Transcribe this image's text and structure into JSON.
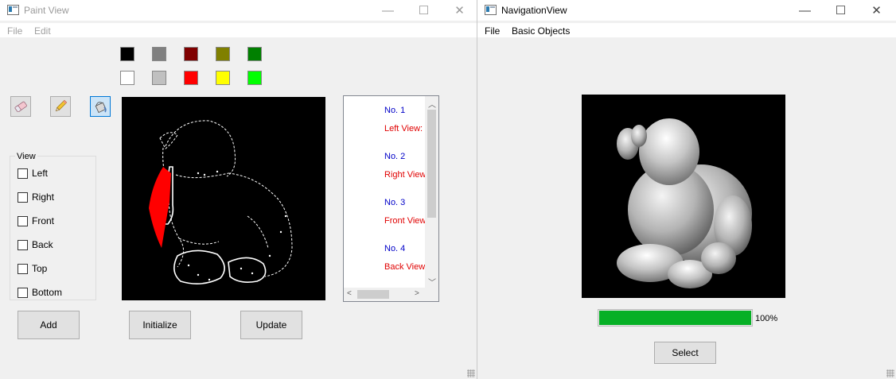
{
  "paint_window": {
    "title": "Paint View",
    "menu": [
      "File",
      "Edit"
    ],
    "palette": [
      [
        "#000000",
        "#808080",
        "#800000",
        "#808000",
        "#008000"
      ],
      [
        "#ffffff",
        "#c0c0c0",
        "#ff0000",
        "#ffff00",
        "#00ff00"
      ]
    ],
    "tools": [
      {
        "icon": "eraser-icon",
        "active": false
      },
      {
        "icon": "pencil-icon",
        "active": false
      },
      {
        "icon": "paint-bucket-icon",
        "active": true
      }
    ],
    "view_group": {
      "title": "View",
      "options": [
        "Left",
        "Right",
        "Front",
        "Back",
        "Top",
        "Bottom"
      ]
    },
    "buttons": {
      "add": "Add",
      "initialize": "Initialize",
      "update": "Update"
    },
    "list_items": [
      {
        "no": "No. 1",
        "view": "Left View:"
      },
      {
        "no": "No. 2",
        "view": "Right View"
      },
      {
        "no": "No. 3",
        "view": "Front View"
      },
      {
        "no": "No. 4",
        "view": "Back View:"
      }
    ]
  },
  "navigation_window": {
    "title": "NavigationView",
    "menu": [
      "File",
      "Basic Objects"
    ],
    "progress": {
      "value": 100,
      "label": "100%",
      "color": "#06b025"
    },
    "select_button": "Select"
  },
  "window_controls": {
    "minimize": "—",
    "maximize": "☐",
    "close": "✕"
  }
}
